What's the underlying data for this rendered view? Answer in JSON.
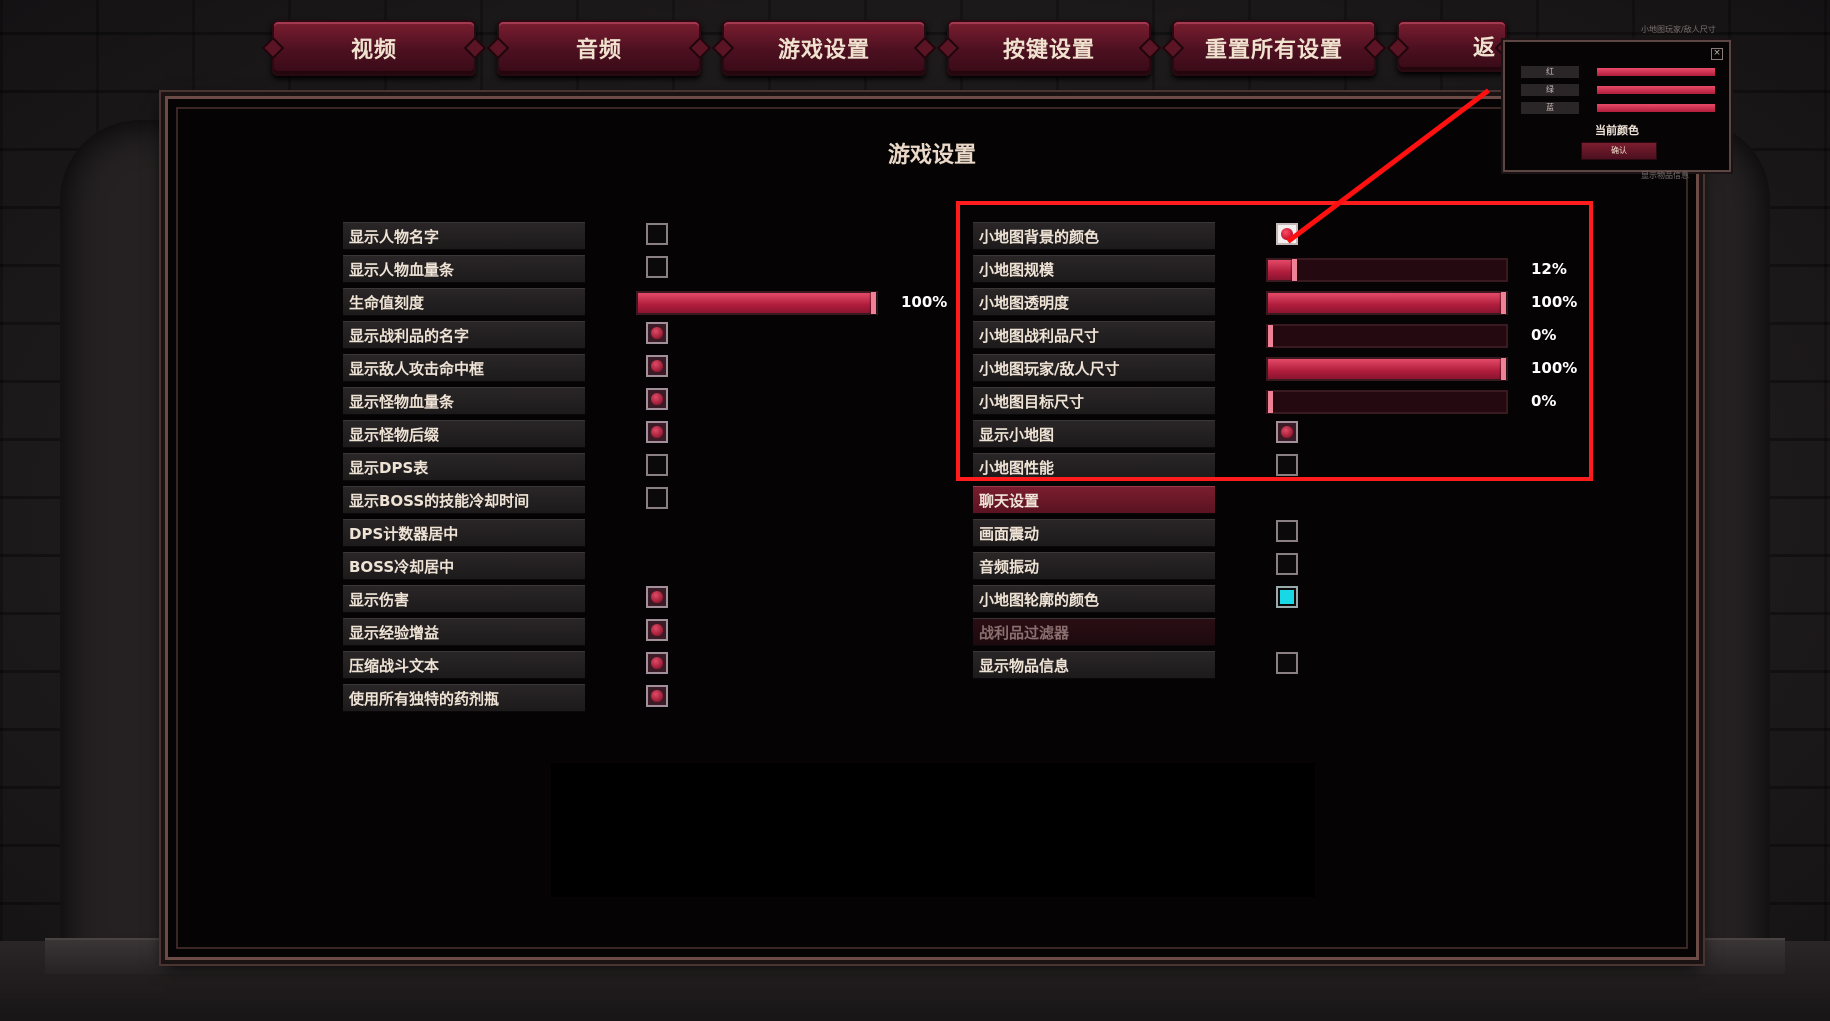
{
  "tabs": [
    "视频",
    "音频",
    "游戏设置",
    "按键设置",
    "重置所有设置",
    "返"
  ],
  "panel_title": "游戏设置",
  "left_items": [
    {
      "label": "显示人物名字",
      "control": "checkbox",
      "checked": false
    },
    {
      "label": "显示人物血量条",
      "control": "checkbox",
      "checked": false
    },
    {
      "label": "生命值刻度",
      "control": "slider",
      "value": 100,
      "value_text": "100%"
    },
    {
      "label": "显示战利品的名字",
      "control": "checkbox",
      "checked": true
    },
    {
      "label": "显示敌人攻击命中框",
      "control": "checkbox",
      "checked": true
    },
    {
      "label": "显示怪物血量条",
      "control": "checkbox",
      "checked": true
    },
    {
      "label": "显示怪物后缀",
      "control": "checkbox",
      "checked": true
    },
    {
      "label": "显示DPS表",
      "control": "checkbox",
      "checked": false
    },
    {
      "label": "显示BOSS的技能冷却时间",
      "control": "checkbox",
      "checked": false
    },
    {
      "label": "DPS计数器居中",
      "control": "none"
    },
    {
      "label": "BOSS冷却居中",
      "control": "none"
    },
    {
      "label": "显示伤害",
      "control": "checkbox",
      "checked": true
    },
    {
      "label": "显示经验增益",
      "control": "checkbox",
      "checked": true
    },
    {
      "label": "压缩战斗文本",
      "control": "checkbox",
      "checked": true
    },
    {
      "label": "使用所有独特的药剂瓶",
      "control": "checkbox",
      "checked": true
    }
  ],
  "right_items": [
    {
      "label": "小地图背景的颜色",
      "control": "checkbox",
      "checked": true,
      "state": "active"
    },
    {
      "label": "小地图规模",
      "control": "slider",
      "value": 12,
      "value_text": "12%"
    },
    {
      "label": "小地图透明度",
      "control": "slider",
      "value": 100,
      "value_text": "100%"
    },
    {
      "label": "小地图战利品尺寸",
      "control": "slider",
      "value": 0,
      "value_text": "0%"
    },
    {
      "label": "小地图玩家/敌人尺寸",
      "control": "slider",
      "value": 100,
      "value_text": "100%"
    },
    {
      "label": "小地图目标尺寸",
      "control": "slider",
      "value": 0,
      "value_text": "0%"
    },
    {
      "label": "显示小地图",
      "control": "checkbox",
      "checked": true
    },
    {
      "label": "小地图性能",
      "control": "checkbox",
      "checked": false
    },
    {
      "label": "聊天设置",
      "control": "header"
    },
    {
      "label": "画面震动",
      "control": "checkbox",
      "checked": false
    },
    {
      "label": "音频振动",
      "control": "checkbox",
      "checked": false
    },
    {
      "label": "小地图轮廓的颜色",
      "control": "color",
      "color": "#18d8e6"
    },
    {
      "label": "战利品过滤器",
      "control": "disabled"
    },
    {
      "label": "显示物品信息",
      "control": "checkbox",
      "checked": false
    }
  ],
  "popup": {
    "header_text": "小地图玩家/敌人尺寸",
    "rows": [
      {
        "label": "红",
        "value": 100
      },
      {
        "label": "绿",
        "value": 100
      },
      {
        "label": "蓝",
        "value": 100
      }
    ],
    "title": "当前颜色",
    "confirm": "确认",
    "footer_text": "显示物品信息"
  },
  "colors": {
    "accent": "#b01d3c",
    "highlight": "#ff1c1c",
    "outline_color": "#18d8e6"
  }
}
